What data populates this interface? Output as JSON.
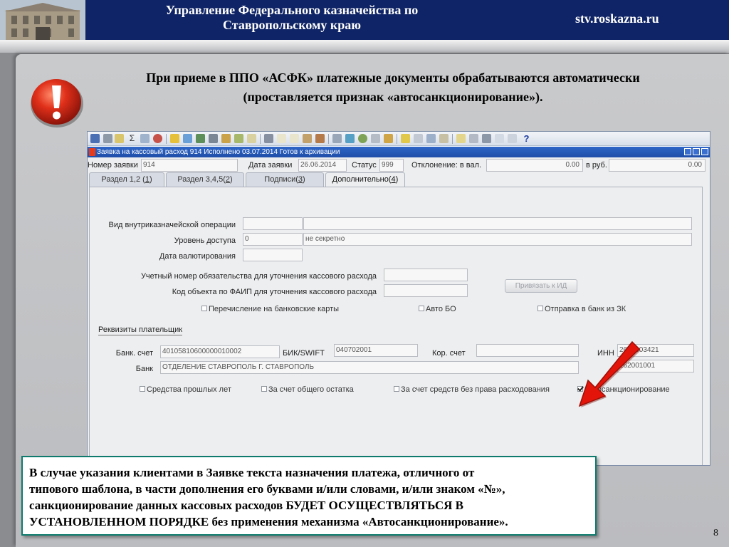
{
  "header": {
    "title_line1": "Управление Федерального казначейства по",
    "title_line2": "Ставропольскому краю",
    "site": "stv.roskazna.ru"
  },
  "slide": {
    "heading_line1": "При приеме в ППО «АСФК» платежные документы обрабатываются автоматически",
    "heading_line2": "(проставляется признак «автосанкционирование»).",
    "note_lines": [
      "В случае указания клиентами в Заявке текста назначения платежа, отличного от",
      "типового шаблона, в части дополнения его буквами и/или словами, и/или знаком «№»,",
      "санкционирование данных кассовых расходов БУДЕТ ОСУЩЕСТВЛЯТЬСЯ В",
      "УСТАНОВЛЕННОМ ПОРЯДКЕ без применения механизма «Автосанкционирование»."
    ],
    "page_number": "8"
  },
  "app": {
    "window_title": "Заявка на кассовый расход 914 Исполнено 03.07.2014 Готов к архивации",
    "toolbar_icons": [
      "save-icon",
      "print-icon",
      "sigma-icon",
      "copy-icon",
      "clock-icon",
      "edit-icon",
      "find-icon",
      "filter-icon",
      "report-icon",
      "folder-icon",
      "attach-icon",
      "cut-icon",
      "paste-icon",
      "undo-icon",
      "redo-icon",
      "pen-icon",
      "doc-icon",
      "settings-icon",
      "stop-icon",
      "lock-icon",
      "export-icon",
      "import-icon",
      "chart-icon",
      "clip-icon",
      "list-icon",
      "gear-icon",
      "bottle-icon",
      "window-icon",
      "help-icon"
    ],
    "header_fields": {
      "request_no_label": "Номер заявки",
      "request_no_value": "914",
      "request_date_label": "Дата заявки",
      "request_date_value": "26.06.2014",
      "status_label": "Статус",
      "status_value": "999",
      "deviation_label": "Отклонение: в вал.",
      "deviation_value": "0.00",
      "rub_label": "в руб.",
      "rub_value": "0.00"
    },
    "tabs": [
      {
        "label": "Раздел 1,2 (",
        "key": "1",
        "active": false
      },
      {
        "label": "Раздел 3,4,5(",
        "key": "2",
        "active": false
      },
      {
        "label": "Подписи(",
        "key": "3",
        "active": false
      },
      {
        "label": "Дополнительно(",
        "key": "4",
        "active": true
      }
    ],
    "tab_suffix": ")",
    "form": {
      "operation_type_label": "Вид внутриказначейской операции",
      "access_level_label": "Уровень доступа",
      "access_level_code": "0",
      "access_level_text": "не секретно",
      "value_date_label": "Дата валютирования",
      "obligation_no_label": "Учетный номер обязательства для уточнения кассового расхода",
      "faip_code_label": "Код объекта по ФАИП для уточнения кассового расхода",
      "bind_button": "Привязать к ИД",
      "chk_bank_cards": "Перечисление на банковские карты",
      "chk_auto_bo": "Авто БО",
      "chk_send_bank": "Отправка в банк из ЗК",
      "payer_section": "Реквизиты плательщик",
      "bank_account_label": "Банк. счет",
      "bank_account_value": "40105810600000010002",
      "bik_label": "БИК/SWIFT",
      "bik_value": "040702001",
      "corr_account_label": "Кор. счет",
      "inn_label": "ИНН",
      "inn_value": "2600003421",
      "bank_label": "Банк",
      "bank_value": "ОТДЕЛЕНИЕ СТАВРОПОЛЬ Г. СТАВРОПОЛЬ",
      "kpp_value": "262001001",
      "chk_prior_years": "Средства прошлых лет",
      "chk_total_balance": "За счет общего остатка",
      "chk_no_spend_right": "За счет средств без права расходования",
      "chk_autosanction": "Автосанкционирование",
      "autosanction_checked": true
    }
  }
}
